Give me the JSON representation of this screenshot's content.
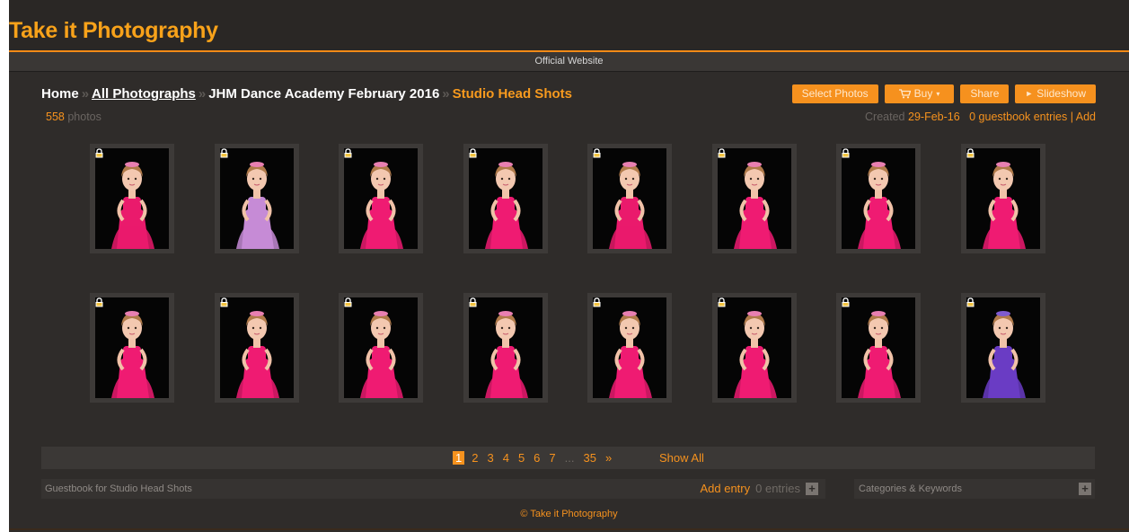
{
  "site": {
    "title": "Take it Photography",
    "subtitle": "Official Website",
    "footer": "© Take it Photography"
  },
  "breadcrumb": {
    "home": "Home",
    "all_photographs": "All Photographs",
    "event": "JHM Dance Academy February 2016",
    "current": "Studio Head Shots",
    "separator": "»"
  },
  "gallery_info": {
    "photo_count": "558",
    "photo_count_label": "photos",
    "created_label": "Created",
    "created_date": "29-Feb-16",
    "guestbook_entries": "0 guestbook entries",
    "pipe": "|",
    "add": "Add"
  },
  "toolbar": {
    "select_photos": "Select Photos",
    "buy": "Buy",
    "buy_caret": "▾",
    "share": "Share",
    "slideshow": "Slideshow",
    "slideshow_icon": "►"
  },
  "thumbnails": [
    {
      "dress": "#ea1a6c",
      "icon": "lock-icon"
    },
    {
      "dress": "#c68bd6",
      "icon": "lock-icon"
    },
    {
      "dress": "#ef1b72",
      "icon": "lock-icon"
    },
    {
      "dress": "#ef1b72",
      "icon": "lock-icon"
    },
    {
      "dress": "#ea1a6c",
      "icon": "lock-icon"
    },
    {
      "dress": "#ef1b72",
      "icon": "lock-icon"
    },
    {
      "dress": "#ef1b72",
      "icon": "lock-icon"
    },
    {
      "dress": "#ef1b72",
      "icon": "lock-icon"
    },
    {
      "dress": "#ef1b72",
      "icon": "lock-icon"
    },
    {
      "dress": "#ef1b72",
      "icon": "lock-icon"
    },
    {
      "dress": "#ef1b72",
      "icon": "lock-icon"
    },
    {
      "dress": "#ef1b72",
      "icon": "lock-icon"
    },
    {
      "dress": "#ef1b72",
      "icon": "lock-icon"
    },
    {
      "dress": "#ef1b72",
      "icon": "lock-icon"
    },
    {
      "dress": "#ef1b72",
      "icon": "lock-icon"
    },
    {
      "dress": "#6a3cc4",
      "icon": "lock-icon"
    }
  ],
  "pagination": {
    "pages": [
      "1",
      "2",
      "3",
      "4",
      "5",
      "6",
      "7",
      "...",
      "35",
      "»"
    ],
    "active": "1",
    "show_all": "Show All"
  },
  "guestbook": {
    "label": "Guestbook for Studio Head Shots",
    "add_entry": "Add entry",
    "entries": "0 entries",
    "plus": "+"
  },
  "categories": {
    "label": "Categories & Keywords",
    "plus": "+"
  },
  "colors": {
    "accent": "#f6921e",
    "background": "#2f2c2a"
  }
}
